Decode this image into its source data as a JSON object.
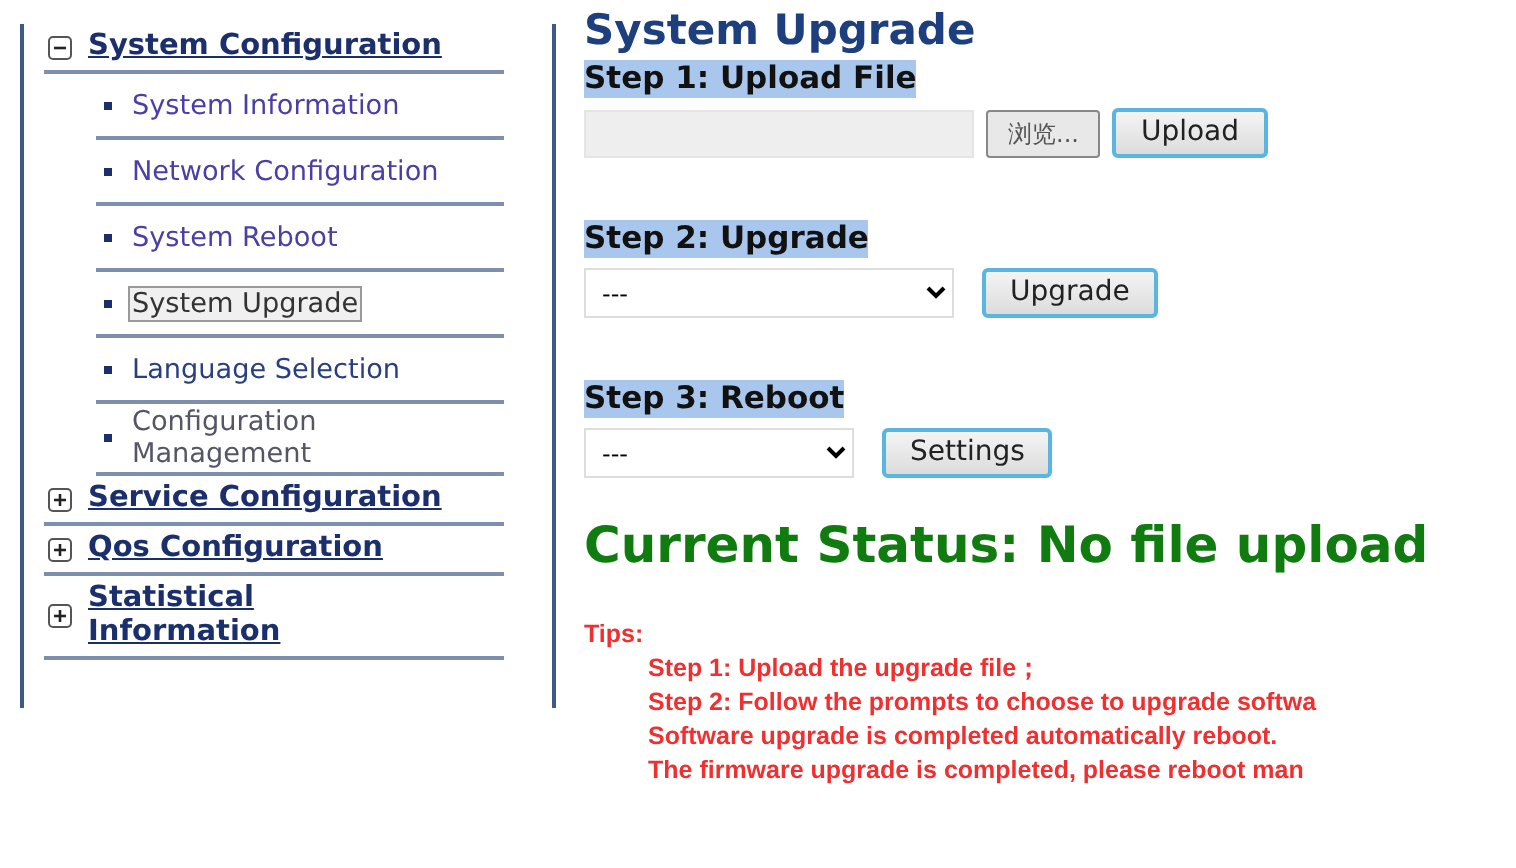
{
  "sidebar": {
    "groups": [
      {
        "label": "System Configuration",
        "expanded": true,
        "items": [
          {
            "label": "System Information",
            "selected": false
          },
          {
            "label": "Network Configuration",
            "selected": false
          },
          {
            "label": "System Reboot",
            "selected": false
          },
          {
            "label": "System Upgrade",
            "selected": true
          },
          {
            "label": "Language Selection",
            "selected": false
          },
          {
            "label": "Configuration Management",
            "selected": false
          }
        ]
      },
      {
        "label": "Service Configuration",
        "expanded": false
      },
      {
        "label": "Qos Configuration",
        "expanded": false
      },
      {
        "label": "Statistical Information",
        "expanded": false
      }
    ]
  },
  "page": {
    "title": "System Upgrade",
    "steps": [
      {
        "heading": "Step 1: Upload File",
        "kind": "file",
        "browse_button": "浏览...",
        "button": "Upload"
      },
      {
        "heading": "Step 2: Upgrade",
        "kind": "select",
        "value": "---",
        "button": "Upgrade"
      },
      {
        "heading": "Step 3: Reboot",
        "kind": "select",
        "value": "---",
        "button": "Settings"
      }
    ],
    "status": "Current Status: No file upload",
    "tips": {
      "label": "Tips:",
      "lines": [
        "Step 1: Upload the upgrade file；",
        "Step 2: Follow the prompts to choose to upgrade softwa",
        "Software upgrade is completed automatically reboot.",
        "The firmware upgrade is completed, please reboot man"
      ]
    }
  }
}
